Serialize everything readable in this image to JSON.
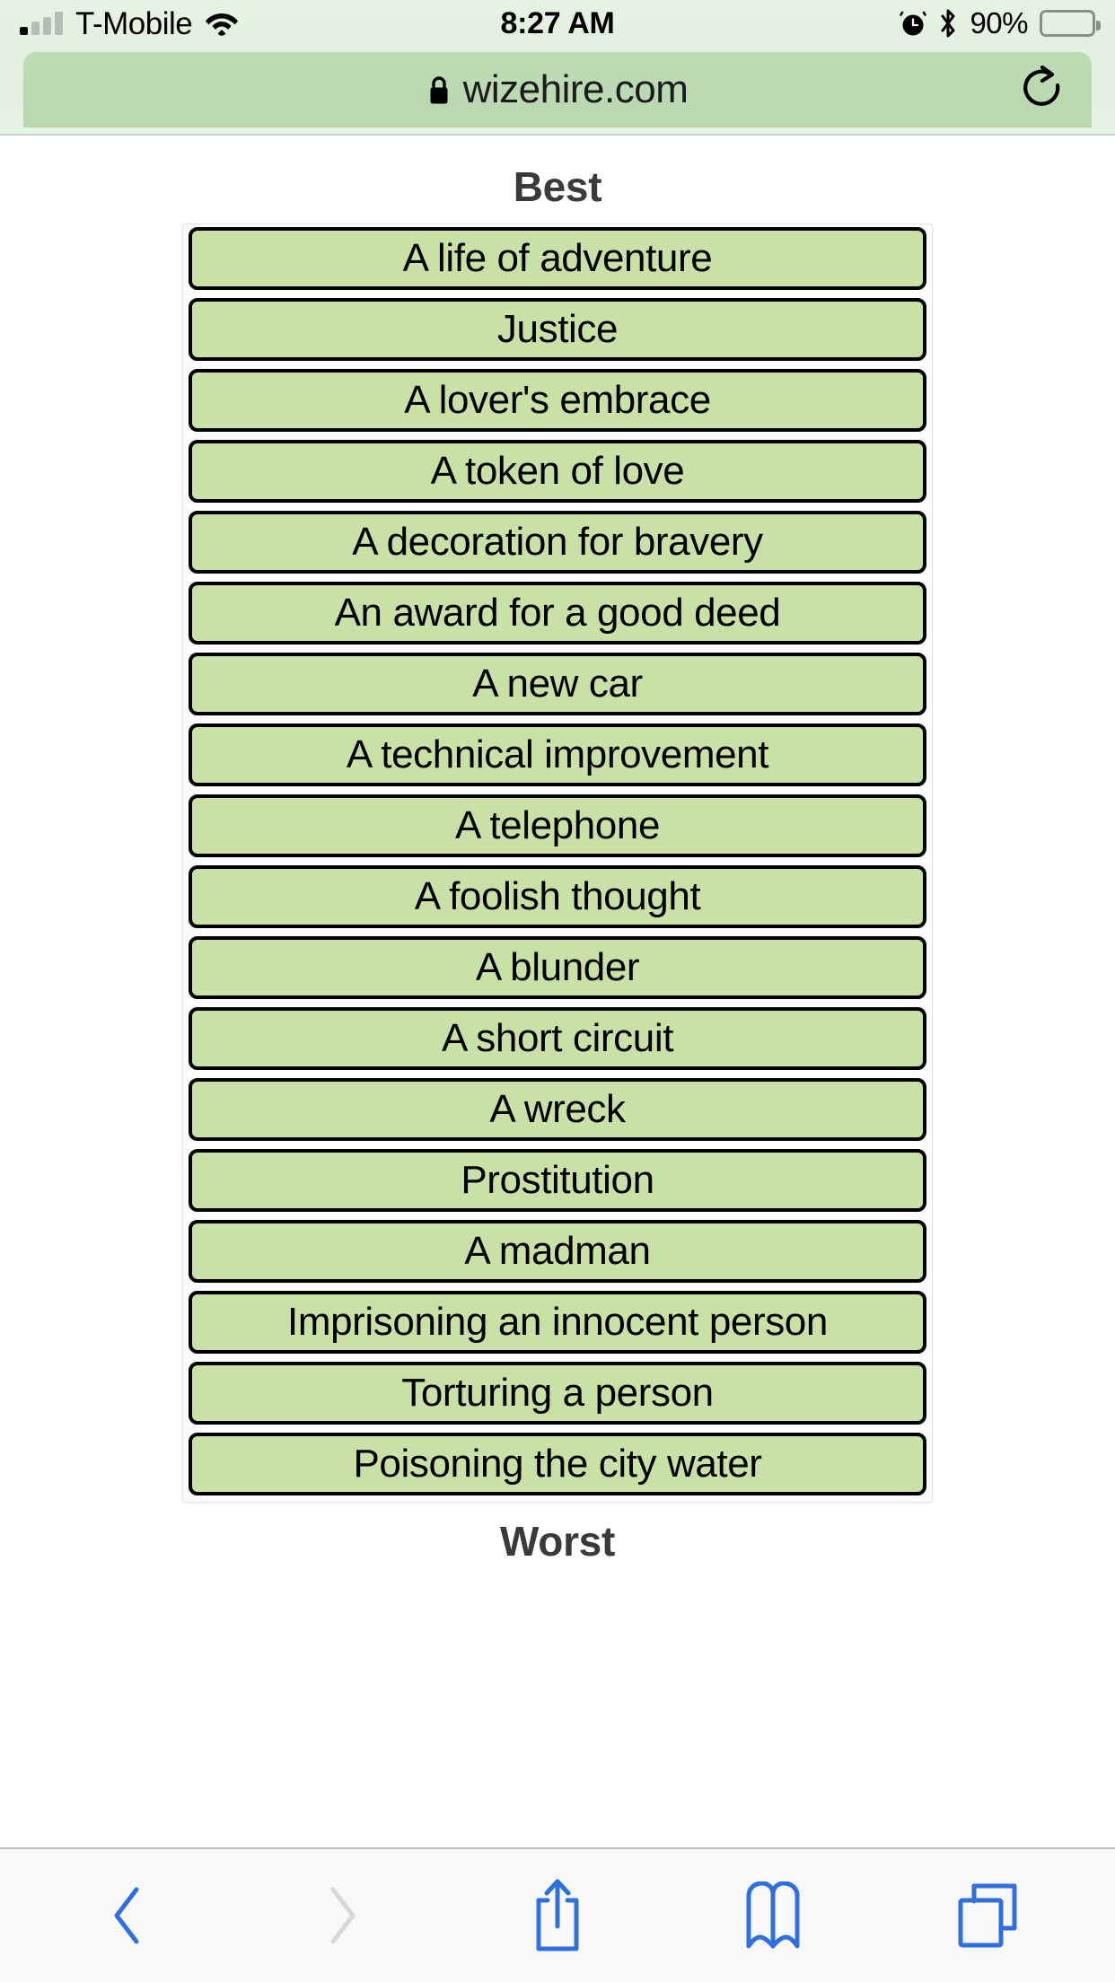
{
  "status_bar": {
    "carrier": "T-Mobile",
    "time": "8:27 AM",
    "battery_percent": "90%",
    "signal_bars_filled": 1,
    "signal_bars_total": 4,
    "icons": {
      "wifi": "wifi-icon",
      "alarm": "alarm-icon",
      "bluetooth": "bluetooth-icon",
      "battery": "battery-icon"
    }
  },
  "browser": {
    "url": "wizehire.com",
    "lock_icon": "lock-icon",
    "reload_icon": "reload-icon"
  },
  "page": {
    "top_label": "Best",
    "bottom_label": "Worst",
    "items": [
      {
        "label": "A life of adventure"
      },
      {
        "label": "Justice"
      },
      {
        "label": "A lover's embrace"
      },
      {
        "label": "A token of love"
      },
      {
        "label": "A decoration for bravery"
      },
      {
        "label": "An award for a good deed"
      },
      {
        "label": "A new car"
      },
      {
        "label": "A technical improvement"
      },
      {
        "label": "A telephone"
      },
      {
        "label": "A foolish thought"
      },
      {
        "label": "A blunder"
      },
      {
        "label": "A short circuit"
      },
      {
        "label": "A wreck"
      },
      {
        "label": "Prostitution"
      },
      {
        "label": "A madman"
      },
      {
        "label": "Imprisoning an innocent person"
      },
      {
        "label": "Torturing a person"
      },
      {
        "label": "Poisoning the city water"
      }
    ],
    "colors": {
      "item_fill": "#c9e0a7",
      "item_border": "#000000",
      "label_text": "#3a3a3a"
    }
  },
  "toolbar": {
    "buttons": [
      {
        "name": "back-button",
        "icon": "chevron-left-icon",
        "enabled": true
      },
      {
        "name": "forward-button",
        "icon": "chevron-right-icon",
        "enabled": false
      },
      {
        "name": "share-button",
        "icon": "share-icon",
        "enabled": true
      },
      {
        "name": "bookmarks-button",
        "icon": "book-icon",
        "enabled": true
      },
      {
        "name": "tabs-button",
        "icon": "tabs-icon",
        "enabled": true
      }
    ],
    "accent_color": "#2f6fe0",
    "disabled_color": "#d8d8d8"
  }
}
